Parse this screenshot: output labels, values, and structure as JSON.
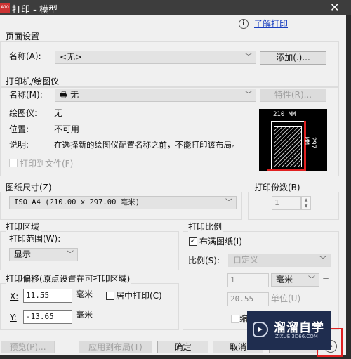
{
  "window": {
    "title": "打印 - 模型",
    "close": "✕",
    "app_icon": "A10"
  },
  "help": {
    "link": "了解打印",
    "icon": "info-icon"
  },
  "page_setup": {
    "title": "页面设置",
    "name_label": "名称(A):",
    "name_value": "<无>",
    "add_button": "添加(.)..."
  },
  "printer": {
    "title": "打印机/绘图仪",
    "name_label": "名称(M):",
    "name_value": "无",
    "properties_button": "特性(R)...",
    "plotter_label": "绘图仪:",
    "plotter_value": "无",
    "location_label": "位置:",
    "location_value": "不可用",
    "desc_label": "说明:",
    "desc_value": "在选择新的绘图仪配置名称之前，不能打印该布局。",
    "print_to_file": "打印到文件(F)",
    "print_to_file_checked": false,
    "preview_width": "210 MM",
    "preview_height": "297 MM"
  },
  "paper_size": {
    "title": "图纸尺寸(Z)",
    "value": "ISO A4 (210.00 x 297.00 毫米)"
  },
  "copies": {
    "title": "打印份数(B)",
    "value": "1"
  },
  "plot_area": {
    "title": "打印区域",
    "range_label": "打印范围(W):",
    "range_value": "显示"
  },
  "offset": {
    "title": "打印偏移(原点设置在可打印区域)",
    "x_label": "X:",
    "x_value": "11.55",
    "x_unit": "毫米",
    "y_label": "Y:",
    "y_value": "-13.65",
    "y_unit": "毫米",
    "center_label": "居中打印(C)",
    "center_checked": false
  },
  "scale": {
    "title": "打印比例",
    "fit_label": "布满图纸(I)",
    "fit_checked": true,
    "scale_label": "比例(S):",
    "scale_value": "自定义",
    "value1": "1",
    "unit1": "毫米",
    "equals": "=",
    "value2": "20.55",
    "unit2": "单位(U)",
    "lineweights_label": "缩"
  },
  "buttons": {
    "preview": "预览(P)...",
    "apply": "应用到布局(T)",
    "ok": "确定",
    "cancel": "取消"
  },
  "watermark": {
    "title": "溜溜自学",
    "url": "ZIXUE.3D66.COM"
  },
  "colors": {
    "highlight": "#e02020",
    "watermark_bg": "#1f2d4f"
  }
}
